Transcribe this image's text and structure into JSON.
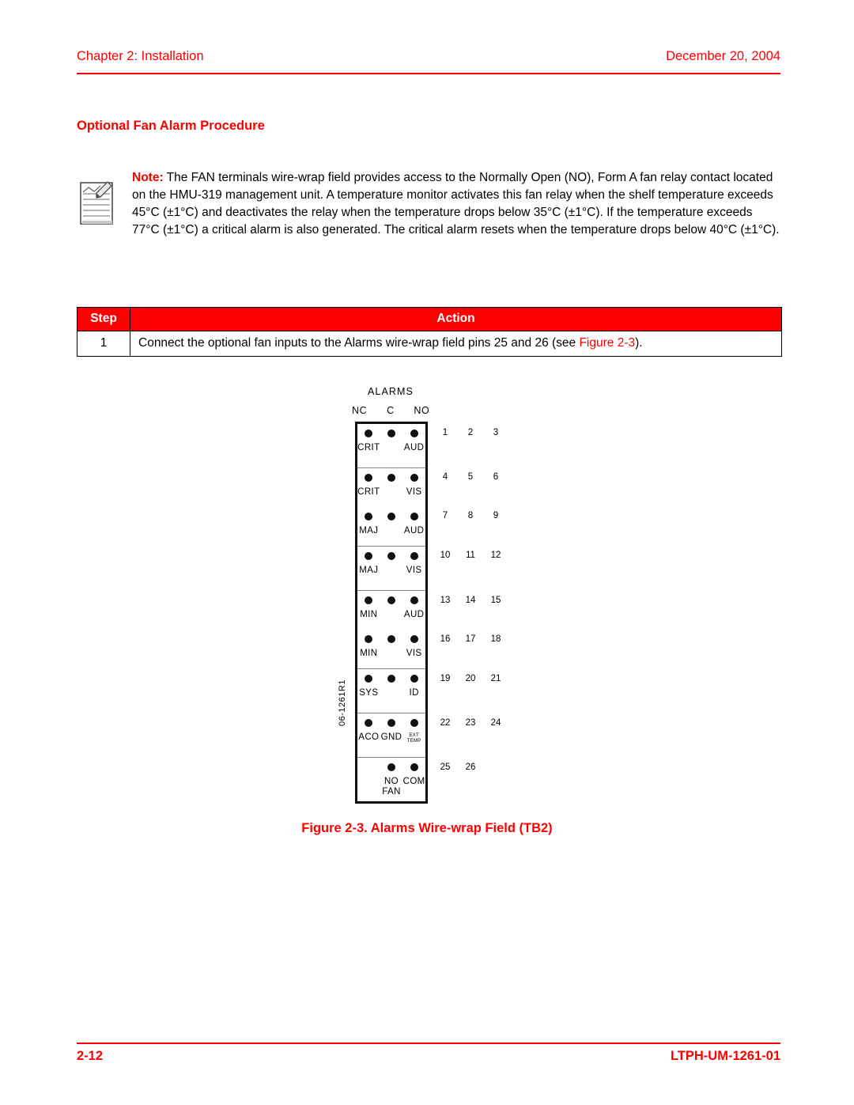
{
  "header": {
    "chapter": "Chapter 2: Installation",
    "date": "December 20, 2004"
  },
  "section": {
    "heading": "Optional Fan Alarm Procedure"
  },
  "note": {
    "icon": "note-pad-pencil-icon",
    "label": "Note:",
    "text": " The FAN terminals wire-wrap field provides access to the Normally Open (NO), Form A fan relay contact located on the HMU-319 management unit. A temperature monitor activates this fan relay when the shelf temperature exceeds 45°C (±1°C) and deactivates the relay when the temperature drops below 35°C (±1°C). If the temperature exceeds 77°C (±1°C) a critical alarm is also generated. The critical alarm resets when the temperature drops below 40°C (±1°C)."
  },
  "step_table": {
    "headers": {
      "step": "Step",
      "action": "Action"
    },
    "rows": [
      {
        "step": "1",
        "action_before": "Connect the optional fan inputs to the Alarms wire-wrap field pins 25 and 26 (see ",
        "action_xref": "Figure 2-3",
        "action_after": ")."
      }
    ],
    "header_bg": "#ff0000",
    "header_fg": "#ffffff"
  },
  "figure": {
    "caption": "Figure 2-3. Alarms Wire-wrap Field (TB2)",
    "block_title": "ALARMS",
    "column_headers": [
      "NC",
      "C",
      "NO"
    ],
    "drawing_id": "06-1261R1",
    "groups": [
      {
        "rows": [
          {
            "left": "CRIT",
            "right": "AUD",
            "pins": [
              "1",
              "2",
              "3"
            ],
            "dots": [
              true,
              true,
              true
            ]
          }
        ]
      },
      {
        "rows": [
          {
            "left": "CRIT",
            "right": "VIS",
            "pins": [
              "4",
              "5",
              "6"
            ],
            "dots": [
              true,
              true,
              true
            ]
          },
          {
            "left": "MAJ",
            "right": "AUD",
            "pins": [
              "7",
              "8",
              "9"
            ],
            "dots": [
              true,
              true,
              true
            ]
          }
        ]
      },
      {
        "rows": [
          {
            "left": "MAJ",
            "right": "VIS",
            "pins": [
              "10",
              "11",
              "12"
            ],
            "dots": [
              true,
              true,
              true
            ]
          }
        ]
      },
      {
        "rows": [
          {
            "left": "MIN",
            "right": "AUD",
            "pins": [
              "13",
              "14",
              "15"
            ],
            "dots": [
              true,
              true,
              true
            ]
          },
          {
            "left": "MIN",
            "right": "VIS",
            "pins": [
              "16",
              "17",
              "18"
            ],
            "dots": [
              true,
              true,
              true
            ]
          }
        ]
      },
      {
        "rows": [
          {
            "left": "SYS",
            "right": "ID",
            "pins": [
              "19",
              "20",
              "21"
            ],
            "dots": [
              true,
              true,
              true
            ]
          }
        ]
      },
      {
        "rows": [
          {
            "left": "ACO",
            "middle": "GND",
            "tiny_line1": "EXT",
            "tiny_line2": "TEMP",
            "pins": [
              "22",
              "23",
              "24"
            ],
            "dots": [
              true,
              true,
              true
            ]
          }
        ]
      },
      {
        "rows": [
          {
            "middle": "NO",
            "right": "COM",
            "sub": "FAN",
            "pins": [
              "25",
              "26"
            ],
            "dots": [
              false,
              true,
              true
            ]
          }
        ]
      }
    ]
  },
  "footer": {
    "page_number": "2-12",
    "document_id": "LTPH-UM-1261-01"
  },
  "colors": {
    "accent": "#ff0000",
    "text": "#000000",
    "divider": "#8a8a80"
  }
}
